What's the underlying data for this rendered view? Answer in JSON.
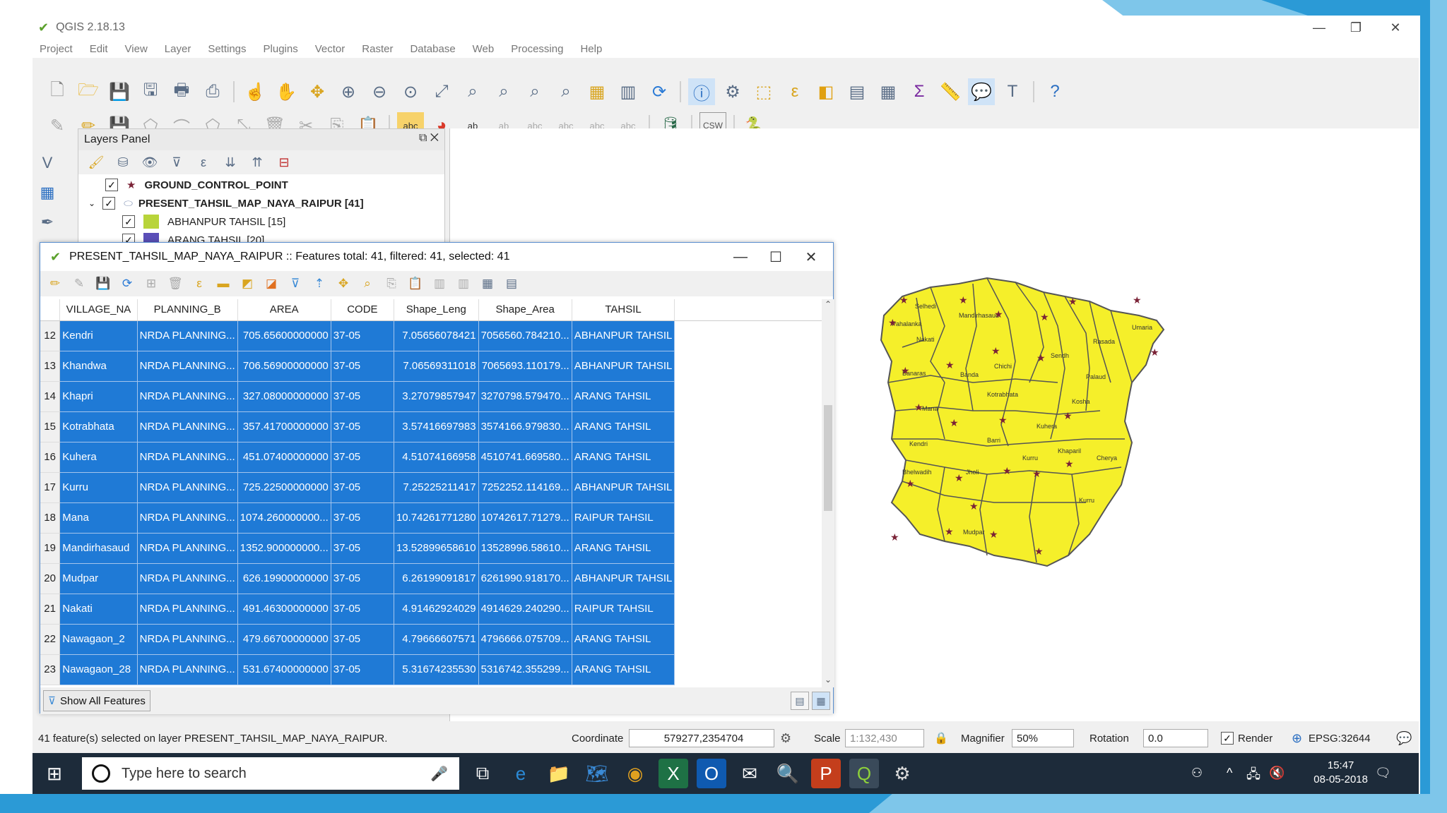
{
  "window": {
    "title": "QGIS 2.18.13",
    "minimize": "—",
    "restore": "❐",
    "close": "✕"
  },
  "menu": [
    "Project",
    "Edit",
    "View",
    "Layer",
    "Settings",
    "Plugins",
    "Vector",
    "Raster",
    "Database",
    "Web",
    "Processing",
    "Help"
  ],
  "toolbar_icons_row1": [
    "new-project-icon",
    "open-project-icon",
    "save-project-icon",
    "save-as-icon",
    "print-composer-icon",
    "composer-manager-icon",
    "touch-zoom-icon",
    "pan-icon",
    "pan-to-selection-icon",
    "zoom-in-icon",
    "zoom-out-icon",
    "zoom-native-icon",
    "zoom-full-icon",
    "zoom-to-selection-icon",
    "zoom-to-layer-icon",
    "zoom-last-icon",
    "zoom-next-icon",
    "new-bookmark-icon",
    "show-bookmarks-icon",
    "refresh-icon",
    "identify-icon",
    "action-icon",
    "select-features-icon",
    "select-value-icon",
    "deselect-icon",
    "open-attribute-table-icon",
    "field-calculator-icon",
    "statistics-icon",
    "measure-icon",
    "map-tips-icon",
    "text-annotation-icon",
    "help-icon"
  ],
  "layers_panel": {
    "title": "Layers Panel",
    "layers": [
      {
        "name": "GROUND_CONTROL_POINT",
        "checked": true,
        "bold": true,
        "symbol": "★"
      },
      {
        "name": "PRESENT_TAHSIL_MAP_NAYA_RAIPUR [41]",
        "checked": true,
        "bold": true,
        "symbol": "⬭"
      },
      {
        "name": "ABHANPUR TAHSIL [15]",
        "checked": true,
        "bold": false,
        "color": "#b8d43a"
      },
      {
        "name": "ARANG TAHSIL [20]",
        "checked": true,
        "bold": false,
        "color": "#5b4fb8"
      }
    ]
  },
  "attribute_table": {
    "title": "PRESENT_TAHSIL_MAP_NAYA_RAIPUR :: Features total: 41, filtered: 41, selected: 41",
    "columns": [
      "VILLAGE_NA",
      "PLANNING_B",
      "AREA",
      "CODE",
      "Shape_Leng",
      "Shape_Area",
      "TAHSIL"
    ],
    "rows": [
      {
        "n": "12",
        "cells": [
          "Kendri",
          "NRDA PLANNING...",
          "705.65600000000",
          "37-05",
          "7.05656078421",
          "7056560.784210...",
          "ABHANPUR TAHSIL"
        ]
      },
      {
        "n": "13",
        "cells": [
          "Khandwa",
          "NRDA PLANNING...",
          "706.56900000000",
          "37-05",
          "7.06569311018",
          "7065693.110179...",
          "ABHANPUR TAHSIL"
        ]
      },
      {
        "n": "14",
        "cells": [
          "Khapri",
          "NRDA PLANNING...",
          "327.08000000000",
          "37-05",
          "3.27079857947",
          "3270798.579470...",
          "ARANG TAHSIL"
        ]
      },
      {
        "n": "15",
        "cells": [
          "Kotrabhata",
          "NRDA PLANNING...",
          "357.41700000000",
          "37-05",
          "3.57416697983",
          "3574166.979830...",
          "ARANG TAHSIL"
        ]
      },
      {
        "n": "16",
        "cells": [
          "Kuhera",
          "NRDA PLANNING...",
          "451.07400000000",
          "37-05",
          "4.51074166958",
          "4510741.669580...",
          "ARANG TAHSIL"
        ]
      },
      {
        "n": "17",
        "cells": [
          "Kurru",
          "NRDA PLANNING...",
          "725.22500000000",
          "37-05",
          "7.25225211417",
          "7252252.114169...",
          "ABHANPUR TAHSIL"
        ]
      },
      {
        "n": "18",
        "cells": [
          "Mana",
          "NRDA PLANNING...",
          "1074.260000000...",
          "37-05",
          "10.74261771280",
          "10742617.71279...",
          "RAIPUR TAHSIL"
        ]
      },
      {
        "n": "19",
        "cells": [
          "Mandirhasaud",
          "NRDA PLANNING...",
          "1352.900000000...",
          "37-05",
          "13.52899658610",
          "13528996.58610...",
          "ARANG TAHSIL"
        ]
      },
      {
        "n": "20",
        "cells": [
          "Mudpar",
          "NRDA PLANNING...",
          "626.19900000000",
          "37-05",
          "6.26199091817",
          "6261990.918170...",
          "ABHANPUR TAHSIL"
        ]
      },
      {
        "n": "21",
        "cells": [
          "Nakati",
          "NRDA PLANNING...",
          "491.46300000000",
          "37-05",
          "4.91462924029",
          "4914629.240290...",
          "RAIPUR TAHSIL"
        ]
      },
      {
        "n": "22",
        "cells": [
          "Nawagaon_2",
          "NRDA PLANNING...",
          "479.66700000000",
          "37-05",
          "4.79666607571",
          "4796666.075709...",
          "ARANG TAHSIL"
        ]
      },
      {
        "n": "23",
        "cells": [
          "Nawagaon_28",
          "NRDA PLANNING...",
          "531.67400000000",
          "37-05",
          "5.31674235530",
          "5316742.355299...",
          "ARANG TAHSIL"
        ]
      }
    ],
    "show_all_label": "Show All Features"
  },
  "map": {
    "village_labels": [
      "Selhedi",
      "Mandirhasaud",
      "Nakati",
      "Banaras",
      "Banda",
      "Chichi",
      "Pahalanka",
      "Mana",
      "Kotrabhata",
      "Palaud",
      "Rasada",
      "Umaria",
      "Kuhera",
      "Kendri",
      "Kurru",
      "Mudpar",
      "Jholi",
      "Kurru",
      "Bhelwadih",
      "Kosha",
      "Barri",
      "Khaparil",
      "Cherya",
      "Sendh"
    ],
    "fill_color": "#f5ef2a",
    "stroke_color": "#555555",
    "point_color": "#7a2236"
  },
  "statusbar": {
    "message": "41 feature(s) selected on layer PRESENT_TAHSIL_MAP_NAYA_RAIPUR.",
    "coordinate_label": "Coordinate",
    "coordinate_value": "579277,2354704",
    "scale_label": "Scale",
    "scale_value": "1:132,430",
    "magnifier_label": "Magnifier",
    "magnifier_value": "50%",
    "rotation_label": "Rotation",
    "rotation_value": "0.0",
    "render_label": "Render",
    "crs_label": "EPSG:32644"
  },
  "taskbar": {
    "search_placeholder": "Type here to search",
    "time": "15:47",
    "date": "08-05-2018"
  }
}
